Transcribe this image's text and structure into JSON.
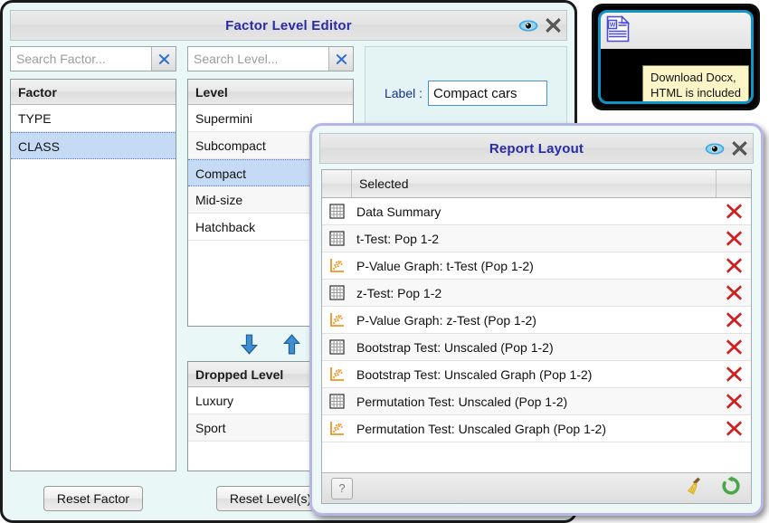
{
  "factor_editor": {
    "title": "Factor Level Editor",
    "search_factor": {
      "placeholder": "Search Factor...",
      "value": ""
    },
    "search_level": {
      "placeholder": "Search Level...",
      "value": ""
    },
    "factor_header": "Factor",
    "factors": [
      {
        "label": "TYPE",
        "selected": false
      },
      {
        "label": "CLASS",
        "selected": true
      }
    ],
    "level_header": "Level",
    "levels": [
      {
        "label": "Supermini",
        "selected": false
      },
      {
        "label": "Subcompact",
        "selected": false
      },
      {
        "label": "Compact",
        "selected": true
      },
      {
        "label": "Mid-size",
        "selected": false
      },
      {
        "label": "Hatchback",
        "selected": false
      }
    ],
    "dropped_header": "Dropped Level",
    "dropped_levels": [
      {
        "label": "Luxury",
        "selected": false
      },
      {
        "label": "Sport",
        "selected": false
      }
    ],
    "label_caption": "Label :",
    "label_value": "Compact cars",
    "reset_factor_button": "Reset Factor",
    "reset_levels_button": "Reset Level(s)",
    "icons": {
      "move_down": "down-arrow-icon",
      "move_up": "up-arrow-icon",
      "preview": "eye-icon",
      "close": "close-x-icon",
      "clear_search": "clear-x-icon"
    }
  },
  "docx_window": {
    "icon": "word-document-icon",
    "tooltip": "Download Docx,\nHTML is included",
    "accent": "#0d95c8"
  },
  "report_layout": {
    "title": "Report Layout",
    "columns": {
      "icon": "",
      "selected": "Selected",
      "delete": ""
    },
    "rows": [
      {
        "icon": "table-icon",
        "label": "Data Summary"
      },
      {
        "icon": "table-icon",
        "label": "t-Test: Pop 1-2"
      },
      {
        "icon": "scatter-icon",
        "label": "P-Value Graph: t-Test (Pop 1-2)"
      },
      {
        "icon": "table-icon",
        "label": "z-Test: Pop 1-2"
      },
      {
        "icon": "scatter-icon",
        "label": "P-Value Graph: z-Test (Pop 1-2)"
      },
      {
        "icon": "table-icon",
        "label": "Bootstrap Test: Unscaled (Pop 1-2)"
      },
      {
        "icon": "scatter-icon",
        "label": "Bootstrap Test: Unscaled Graph (Pop 1-2)"
      },
      {
        "icon": "table-icon",
        "label": "Permutation Test: Unscaled (Pop 1-2)"
      },
      {
        "icon": "scatter-icon",
        "label": "Permutation Test: Unscaled Graph (Pop 1-2)"
      }
    ],
    "footer": {
      "help": "?",
      "clear": "broom-icon",
      "refresh": "refresh-icon"
    },
    "icons": {
      "preview": "eye-icon",
      "close": "close-x-icon",
      "delete_row": "red-x-icon"
    },
    "colors": {
      "title": "#2a2aa8",
      "delete": "#cf1f20",
      "scatter": "#f0921e",
      "border": "#b9b4e6"
    }
  }
}
